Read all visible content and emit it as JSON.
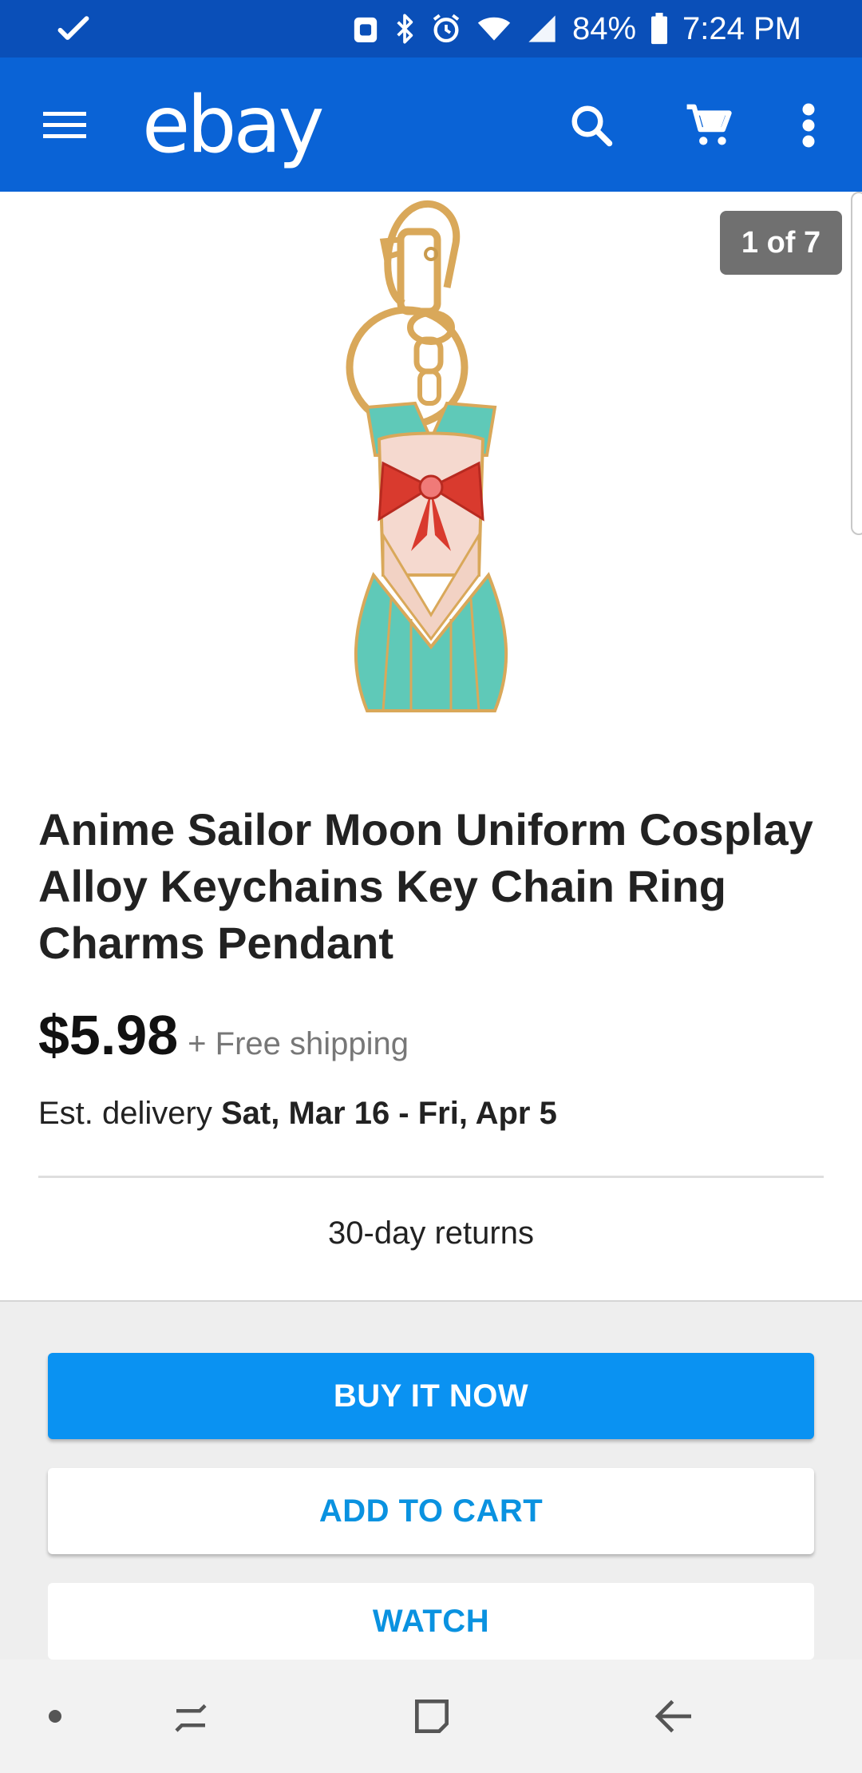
{
  "status_bar": {
    "battery_percent": "84%",
    "time": "7:24 PM",
    "icons": [
      "check-icon",
      "android-icon",
      "bluetooth-icon",
      "alarm-icon",
      "wifi-icon",
      "signal-icon",
      "battery-icon"
    ]
  },
  "app_bar": {
    "logo": "ebay",
    "actions": [
      "menu-icon",
      "search-icon",
      "cart-icon",
      "more-vert-icon"
    ]
  },
  "gallery": {
    "counter": "1 of 7"
  },
  "product": {
    "title": "Anime Sailor Moon Uniform Cosplay Alloy Keychains Key Chain Ring Charms Pendant",
    "price": "$5.98",
    "shipping": "+ Free shipping",
    "delivery_label": "Est. delivery",
    "delivery_dates": "Sat, Mar 16 - Fri, Apr 5",
    "returns": "30-day returns"
  },
  "actions": {
    "buy_now": "BUY IT NOW",
    "add_to_cart": "ADD TO CART",
    "watch": "WATCH"
  },
  "colors": {
    "status_bar": "#0a4fb8",
    "app_bar": "#0a63d6",
    "primary_button": "#0a92f2",
    "secondary_text": "#0a92e0",
    "action_background": "#eeeeee"
  },
  "nav_bar": {
    "items": [
      "dot-icon",
      "recent-apps-icon",
      "home-icon",
      "back-icon"
    ]
  }
}
